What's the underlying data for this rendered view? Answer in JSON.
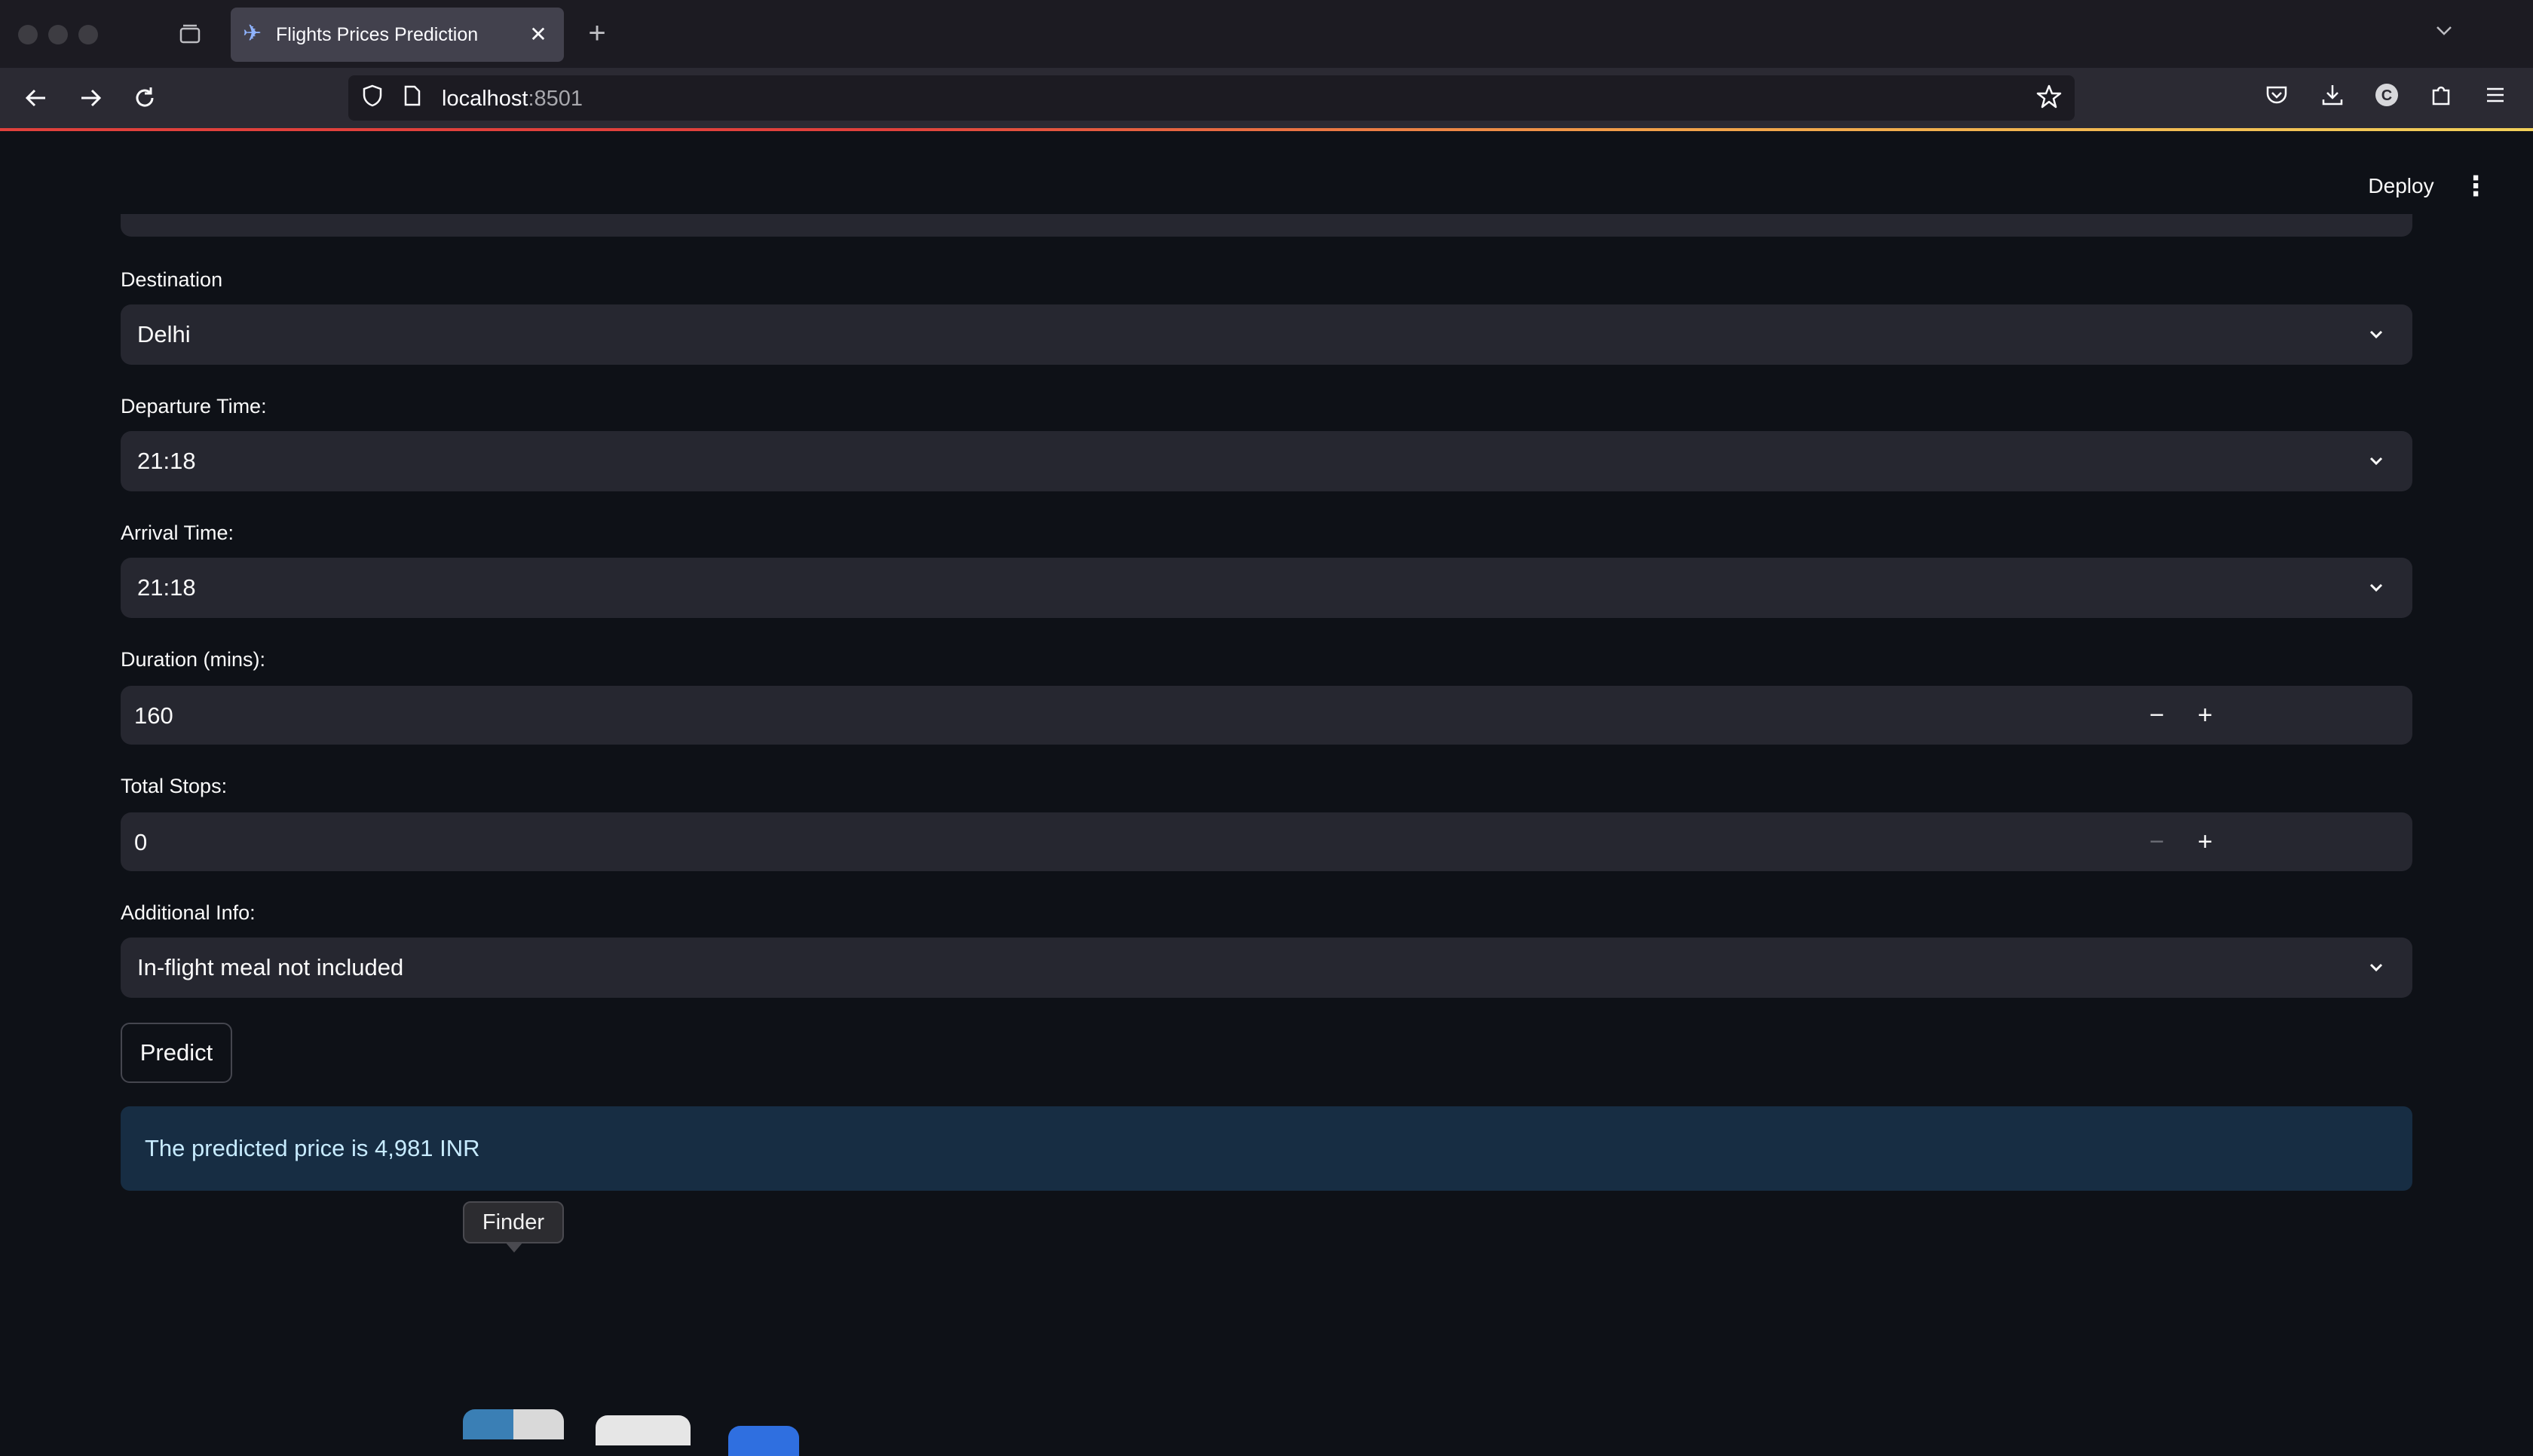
{
  "browser": {
    "tab_title": "Flights Prices Prediction",
    "url_host": "localhost",
    "url_port": ":8501"
  },
  "header": {
    "deploy_label": "Deploy"
  },
  "form": {
    "destination": {
      "label": "Destination",
      "value": "Delhi"
    },
    "departure_time": {
      "label": "Departure Time:",
      "value": "21:18"
    },
    "arrival_time": {
      "label": "Arrival Time:",
      "value": "21:18"
    },
    "duration": {
      "label": "Duration (mins):",
      "value": "160"
    },
    "total_stops": {
      "label": "Total Stops:",
      "value": "0"
    },
    "additional_info": {
      "label": "Additional Info:",
      "value": "In-flight meal not included"
    },
    "predict_label": "Predict"
  },
  "result": {
    "text": "The predicted price is 4,981 INR"
  },
  "dock": {
    "tooltip": "Finder"
  },
  "colors": {
    "background": "#0e1117",
    "input": "#262730",
    "result_bg": "#172d43",
    "result_text": "#c7ebff"
  }
}
